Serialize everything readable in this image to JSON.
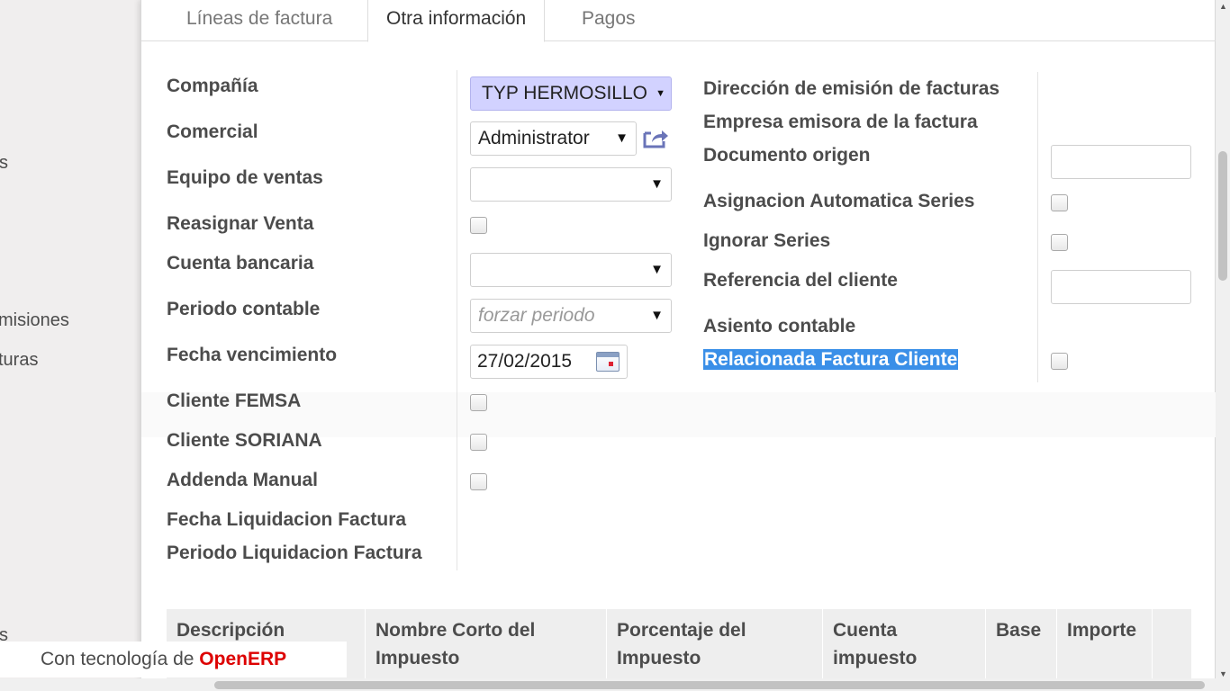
{
  "sidebar": {
    "items": [
      {
        "label": "s"
      },
      {
        "label": "misiones"
      },
      {
        "label": "turas"
      },
      {
        "label": "s"
      }
    ]
  },
  "tabs": [
    {
      "label": "Líneas de factura",
      "active": false
    },
    {
      "label": "Otra información",
      "active": true
    },
    {
      "label": "Pagos",
      "active": false
    }
  ],
  "left_form": {
    "company": {
      "label": "Compañía",
      "value": "TYP HERMOSILLO"
    },
    "salesperson": {
      "label": "Comercial",
      "value": "Administrator"
    },
    "sales_team": {
      "label": "Equipo de ventas",
      "value": ""
    },
    "reassign_sale": {
      "label": "Reasignar Venta",
      "checked": false
    },
    "bank_account": {
      "label": "Cuenta bancaria",
      "value": ""
    },
    "period": {
      "label": "Periodo contable",
      "placeholder": "forzar periodo"
    },
    "due_date": {
      "label": "Fecha vencimiento",
      "value": "27/02/2015"
    },
    "client_femsa": {
      "label": "Cliente FEMSA",
      "checked": false
    },
    "client_soriana": {
      "label": "Cliente SORIANA",
      "checked": false
    },
    "manual_addenda": {
      "label": "Addenda Manual",
      "checked": false
    },
    "settlement_date": {
      "label": "Fecha Liquidacion Factura"
    },
    "settlement_period": {
      "label": "Periodo Liquidacion Factura"
    }
  },
  "right_form": {
    "invoice_address": {
      "label": "Dirección de emisión de facturas"
    },
    "issuing_company": {
      "label": "Empresa emisora de la factura"
    },
    "source_document": {
      "label": "Documento origen",
      "value": ""
    },
    "auto_series": {
      "label": "Asignacion Automatica Series",
      "checked": false
    },
    "ignore_series": {
      "label": "Ignorar Series",
      "checked": false
    },
    "client_reference": {
      "label": "Referencia del cliente",
      "value": ""
    },
    "journal_entry": {
      "label": "Asiento contable"
    },
    "related_invoice": {
      "label": "Relacionada Factura Cliente",
      "checked": false
    }
  },
  "tax_table": {
    "columns": [
      {
        "label": "Descripción impuesto"
      },
      {
        "label": "Nombre Corto del Impuesto"
      },
      {
        "label": "Porcentaje del Impuesto"
      },
      {
        "label": "Cuenta impuesto"
      },
      {
        "label": "Base"
      },
      {
        "label": "Importe"
      }
    ]
  },
  "footer": {
    "prefix": "Con tecnología de ",
    "brand": "OpenERP"
  }
}
